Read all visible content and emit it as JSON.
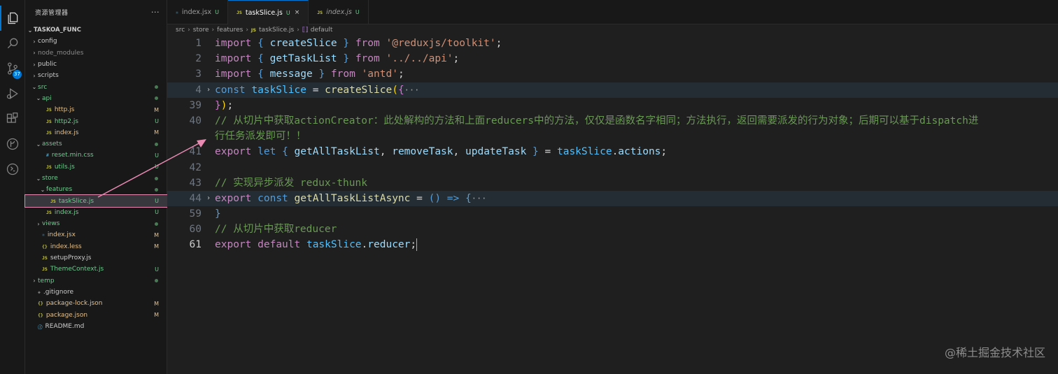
{
  "explorer": {
    "title": "资源管理器",
    "more": "···",
    "project": "TASKOA_FUNC",
    "badge": "37",
    "items": [
      {
        "label": "config",
        "type": "folder",
        "depth": 1
      },
      {
        "label": "node_modules",
        "type": "folder",
        "depth": 1,
        "dim": true
      },
      {
        "label": "public",
        "type": "folder",
        "depth": 1
      },
      {
        "label": "scripts",
        "type": "folder",
        "depth": 1
      },
      {
        "label": "src",
        "type": "folder-open",
        "depth": 1,
        "dot": true
      },
      {
        "label": "api",
        "type": "folder-open",
        "depth": 2,
        "dot": true
      },
      {
        "label": "http.js",
        "type": "js",
        "depth": 3,
        "status": "M"
      },
      {
        "label": "http2.js",
        "type": "js",
        "depth": 3,
        "status": "U"
      },
      {
        "label": "index.js",
        "type": "js",
        "depth": 3,
        "status": "M"
      },
      {
        "label": "assets",
        "type": "folder-open",
        "depth": 2,
        "dot": true
      },
      {
        "label": "reset.min.css",
        "type": "css",
        "depth": 3,
        "status": "U"
      },
      {
        "label": "utils.js",
        "type": "js",
        "depth": 3,
        "status": "U"
      },
      {
        "label": "store",
        "type": "folder-open",
        "depth": 2,
        "dot": true
      },
      {
        "label": "features",
        "type": "folder-open",
        "depth": 3,
        "dot": true
      },
      {
        "label": "taskSlice.js",
        "type": "js",
        "depth": 4,
        "status": "U",
        "selected": true
      },
      {
        "label": "index.js",
        "type": "js",
        "depth": 3,
        "status": "U"
      },
      {
        "label": "views",
        "type": "folder",
        "depth": 2,
        "dot": true
      },
      {
        "label": "index.jsx",
        "type": "react",
        "depth": 2,
        "status": "M"
      },
      {
        "label": "index.less",
        "type": "less",
        "depth": 2,
        "status": "M"
      },
      {
        "label": "setupProxy.js",
        "type": "js",
        "depth": 2
      },
      {
        "label": "ThemeContext.js",
        "type": "js",
        "depth": 2,
        "status": "U"
      },
      {
        "label": "temp",
        "type": "folder",
        "depth": 1,
        "dot": true
      },
      {
        "label": ".gitignore",
        "type": "git",
        "depth": 1
      },
      {
        "label": "package-lock.json",
        "type": "json",
        "depth": 1,
        "status": "M"
      },
      {
        "label": "package.json",
        "type": "json",
        "depth": 1,
        "status": "M"
      },
      {
        "label": "README.md",
        "type": "md",
        "depth": 1
      }
    ]
  },
  "tabs": [
    {
      "label": "index.jsx",
      "icon": "react-icon",
      "mark": "U",
      "active": false
    },
    {
      "label": "taskSlice.js",
      "icon": "JS",
      "mark": "U",
      "active": true,
      "close": "×"
    },
    {
      "label": "index.js",
      "icon": "JS",
      "mark": "U",
      "active": false
    }
  ],
  "breadcrumb": [
    "src",
    "store",
    "features",
    "taskSlice.js",
    "default"
  ],
  "code": {
    "line_numbers": [
      "1",
      "2",
      "3",
      "4",
      "39",
      "40",
      "",
      "41",
      "42",
      "43",
      "44",
      "59",
      "60",
      "61"
    ],
    "comment_line40_part1": "// 从切片中获取actionCreator：此处解构的方法和上面reducers中的方法，仅仅是函数名字相同；方法执行，返回需要派发的行为对象；后期可以基于dispatch进",
    "comment_line40_part2": "行任务派发即可！！",
    "comment_line43": "// 实现异步派发 redux-thunk",
    "comment_line60": "// 从切片中获取reducer",
    "str_toolkit": "'@reduxjs/toolkit'",
    "str_api": "'../../api'",
    "str_antd": "'antd'"
  },
  "watermark": "@稀土掘金技术社区",
  "colors": {
    "accent": "#0078d4",
    "arrow": "#e98ab2"
  }
}
